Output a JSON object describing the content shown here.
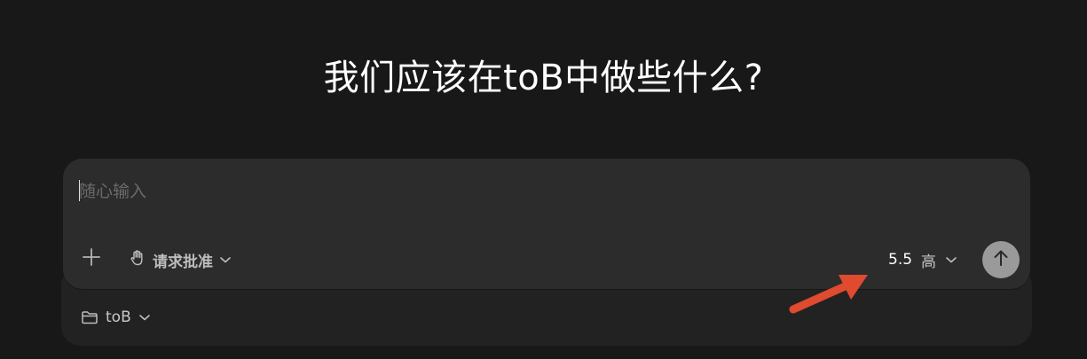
{
  "title": "我们应该在toB中做些什么?",
  "composer": {
    "placeholder": "随心输入",
    "value": ""
  },
  "toolbar": {
    "add_icon": "plus-icon",
    "approval_icon": "hand-icon",
    "approval_label": "请求批准",
    "model_version": "5.5",
    "model_effort": "高",
    "send_icon": "arrow-up-icon"
  },
  "footer": {
    "folder_icon": "folder-icon",
    "folder_label": "toB"
  },
  "colors": {
    "background": "#181818",
    "composer": "#2c2c2c",
    "footer": "#222222",
    "send_button": "#9a9a9a",
    "annotation": "#e04a2f"
  }
}
